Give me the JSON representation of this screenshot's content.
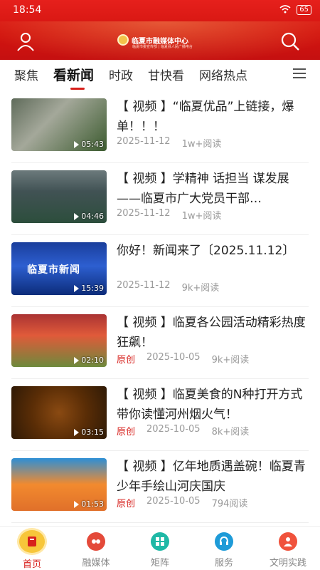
{
  "status": {
    "time": "18:54",
    "battery": "65"
  },
  "header": {
    "logo_title": "临夏市融媒体中心",
    "logo_subtitle": "临夏市委宣传部 | 临夏县人民广播电台"
  },
  "tabs": [
    {
      "label": "聚焦"
    },
    {
      "label": "看新闻"
    },
    {
      "label": "时政"
    },
    {
      "label": "甘快看"
    },
    {
      "label": "网络热点"
    }
  ],
  "news": [
    {
      "title": "【 视频 】“临夏优品”上链接，爆单！！！",
      "origin": "",
      "date": "2025-11-12",
      "reads": "1w+阅读",
      "duration": "05:43"
    },
    {
      "title": "【 视频 】学精神 话担当 谋发展——临夏市广大党员干部…",
      "origin": "",
      "date": "2025-11-12",
      "reads": "1w+阅读",
      "duration": "04:46"
    },
    {
      "title": "你好！新闻来了〔2025.11.12〕",
      "origin": "",
      "date": "2025-11-12",
      "reads": "9k+阅读",
      "duration": "15:39",
      "thumb_caption": "临夏市新闻"
    },
    {
      "title": "【 视频 】临夏各公园活动精彩热度狂飙！",
      "origin": "原创",
      "date": "2025-10-05",
      "reads": "9k+阅读",
      "duration": "02:10"
    },
    {
      "title": "【 视频 】临夏美食的N种打开方式  带你读懂河州烟火气！",
      "origin": "原创",
      "date": "2025-10-05",
      "reads": "8k+阅读",
      "duration": "03:15"
    },
    {
      "title": "【 视频 】亿年地质遇盖碗！临夏青少年手绘山河庆国庆",
      "origin": "原创",
      "date": "2025-10-05",
      "reads": "794阅读",
      "duration": "01:53"
    }
  ],
  "bottom_nav": [
    {
      "label": "首页",
      "icon": "home-icon",
      "active": true
    },
    {
      "label": "融媒体",
      "icon": "media-icon"
    },
    {
      "label": "矩阵",
      "icon": "matrix-icon"
    },
    {
      "label": "服务",
      "icon": "service-icon"
    },
    {
      "label": "文明实践",
      "icon": "civilization-icon"
    }
  ],
  "colors": {
    "brand_red": "#d7201c",
    "active_nav": "#f7c63a"
  }
}
